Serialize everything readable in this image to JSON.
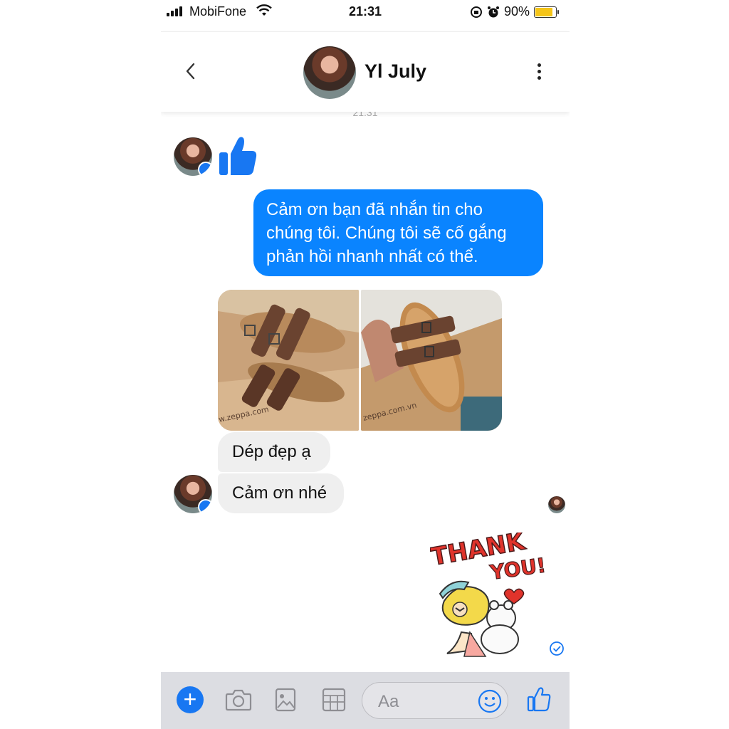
{
  "status_bar": {
    "carrier": "MobiFone",
    "time": "21:31",
    "battery": "90%",
    "battery_level": 0.9
  },
  "header": {
    "contact_name": "Yl July",
    "back_icon": "chevron-left-icon",
    "menu_icon": "more-vertical-icon"
  },
  "chat": {
    "faded_timestamp": "21:31",
    "reaction": "thumbs-up-icon",
    "outgoing_message": "Cảm ơn bạn đã nhắn tin cho chúng tôi. Chúng tôi sẽ cố gắng phản hồi nhanh nhất có thể.",
    "photo1_caption": "w.zeppa.com",
    "photo2_caption": "zeppa.com.vn",
    "incoming": [
      "Dép đẹp ạ",
      "Cảm ơn nhé"
    ],
    "sticker_text": [
      "THANK",
      "YOU!"
    ]
  },
  "composer": {
    "placeholder": "Aa",
    "icons": [
      "plus-icon",
      "camera-icon",
      "gallery-icon",
      "sticker-icon",
      "emoji-icon",
      "like-icon"
    ]
  },
  "colors": {
    "accent": "#0a84ff",
    "messenger_blue": "#1877f2",
    "incoming_bubble": "#efefef",
    "composer_bg": "#dcdde2"
  }
}
